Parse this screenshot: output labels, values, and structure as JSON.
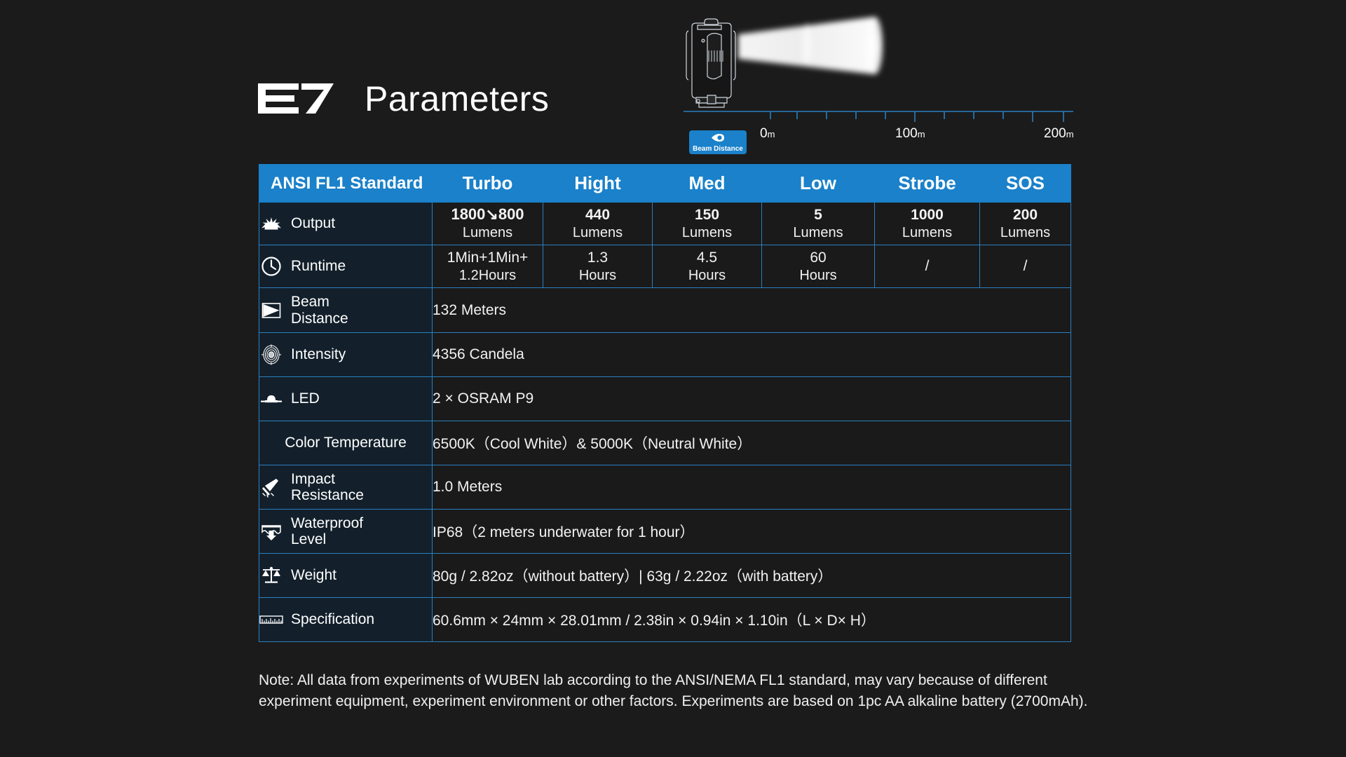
{
  "title": {
    "model": "E7",
    "heading": "Parameters"
  },
  "beam_illustration": {
    "badge_label": "Beam Distance",
    "badge_icon": "beam-eye-icon",
    "badge_color": "#1a81ca",
    "ruler_ticks": [
      {
        "label": "0",
        "unit": "m"
      },
      {
        "label": "100",
        "unit": "m"
      },
      {
        "label": "200",
        "unit": "m"
      }
    ]
  },
  "table": {
    "accent_color": "#1a81ca",
    "border_color": "#2b7fc0",
    "headers": [
      "ANSI FL1 Standard",
      "Turbo",
      "Hight",
      "Med",
      "Low",
      "Strobe",
      "SOS"
    ],
    "rows": [
      {
        "icon": "sunburst-icon",
        "label": "Output",
        "type": "modes",
        "cells": [
          {
            "value": "1800↘800",
            "unit": "Lumens",
            "bold": true
          },
          {
            "value": "440",
            "unit": "Lumens",
            "bold": true
          },
          {
            "value": "150",
            "unit": "Lumens",
            "bold": true
          },
          {
            "value": "5",
            "unit": "Lumens",
            "bold": true
          },
          {
            "value": "1000",
            "unit": "Lumens",
            "bold": true
          },
          {
            "value": "200",
            "unit": "Lumens",
            "bold": true
          }
        ]
      },
      {
        "icon": "clock-icon",
        "label": "Runtime",
        "type": "modes",
        "cells": [
          {
            "value": "1Min+1Min+",
            "unit": "1.2Hours",
            "bold": false
          },
          {
            "value": "1.3",
            "unit": "Hours",
            "bold": false
          },
          {
            "value": "4.5",
            "unit": "Hours",
            "bold": false
          },
          {
            "value": "60",
            "unit": "Hours",
            "bold": false
          },
          {
            "value": "/",
            "unit": "",
            "bold": false
          },
          {
            "value": "/",
            "unit": "",
            "bold": false
          }
        ]
      },
      {
        "icon": "beam-cone-icon",
        "label": "Beam\nDistance",
        "type": "span",
        "value": "132 Meters"
      },
      {
        "icon": "target-rings-icon",
        "label": "Intensity",
        "type": "span",
        "value": "4356 Candela"
      },
      {
        "icon": "led-icon",
        "label": "LED",
        "type": "span",
        "value": "2 × OSRAM P9"
      },
      {
        "icon": "",
        "label": "Color Temperature",
        "type": "span",
        "value": "6500K（Cool White）& 5000K（Neutral White）"
      },
      {
        "icon": "impact-hammer-icon",
        "label": "Impact\nResistance",
        "type": "span",
        "value": "1.0 Meters"
      },
      {
        "icon": "waterproof-icon",
        "label": "Waterproof\nLevel",
        "type": "span",
        "value": "IP68（2 meters underwater for 1 hour）"
      },
      {
        "icon": "scale-icon",
        "label": "Weight",
        "type": "span",
        "value": "80g / 2.82oz（without battery）| 63g / 2.22oz（with battery）"
      },
      {
        "icon": "ruler-icon",
        "label": "Specification",
        "type": "span",
        "value": "60.6mm × 24mm × 28.01mm / 2.38in × 0.94in × 1.10in（L × D× H）"
      }
    ]
  },
  "note": "Note: All data from experiments of WUBEN lab according to the ANSI/NEMA FL1 standard, may vary because of different experiment equipment, experiment environment or other factors. Experiments are based on 1pc AA alkaline battery (2700mAh)."
}
